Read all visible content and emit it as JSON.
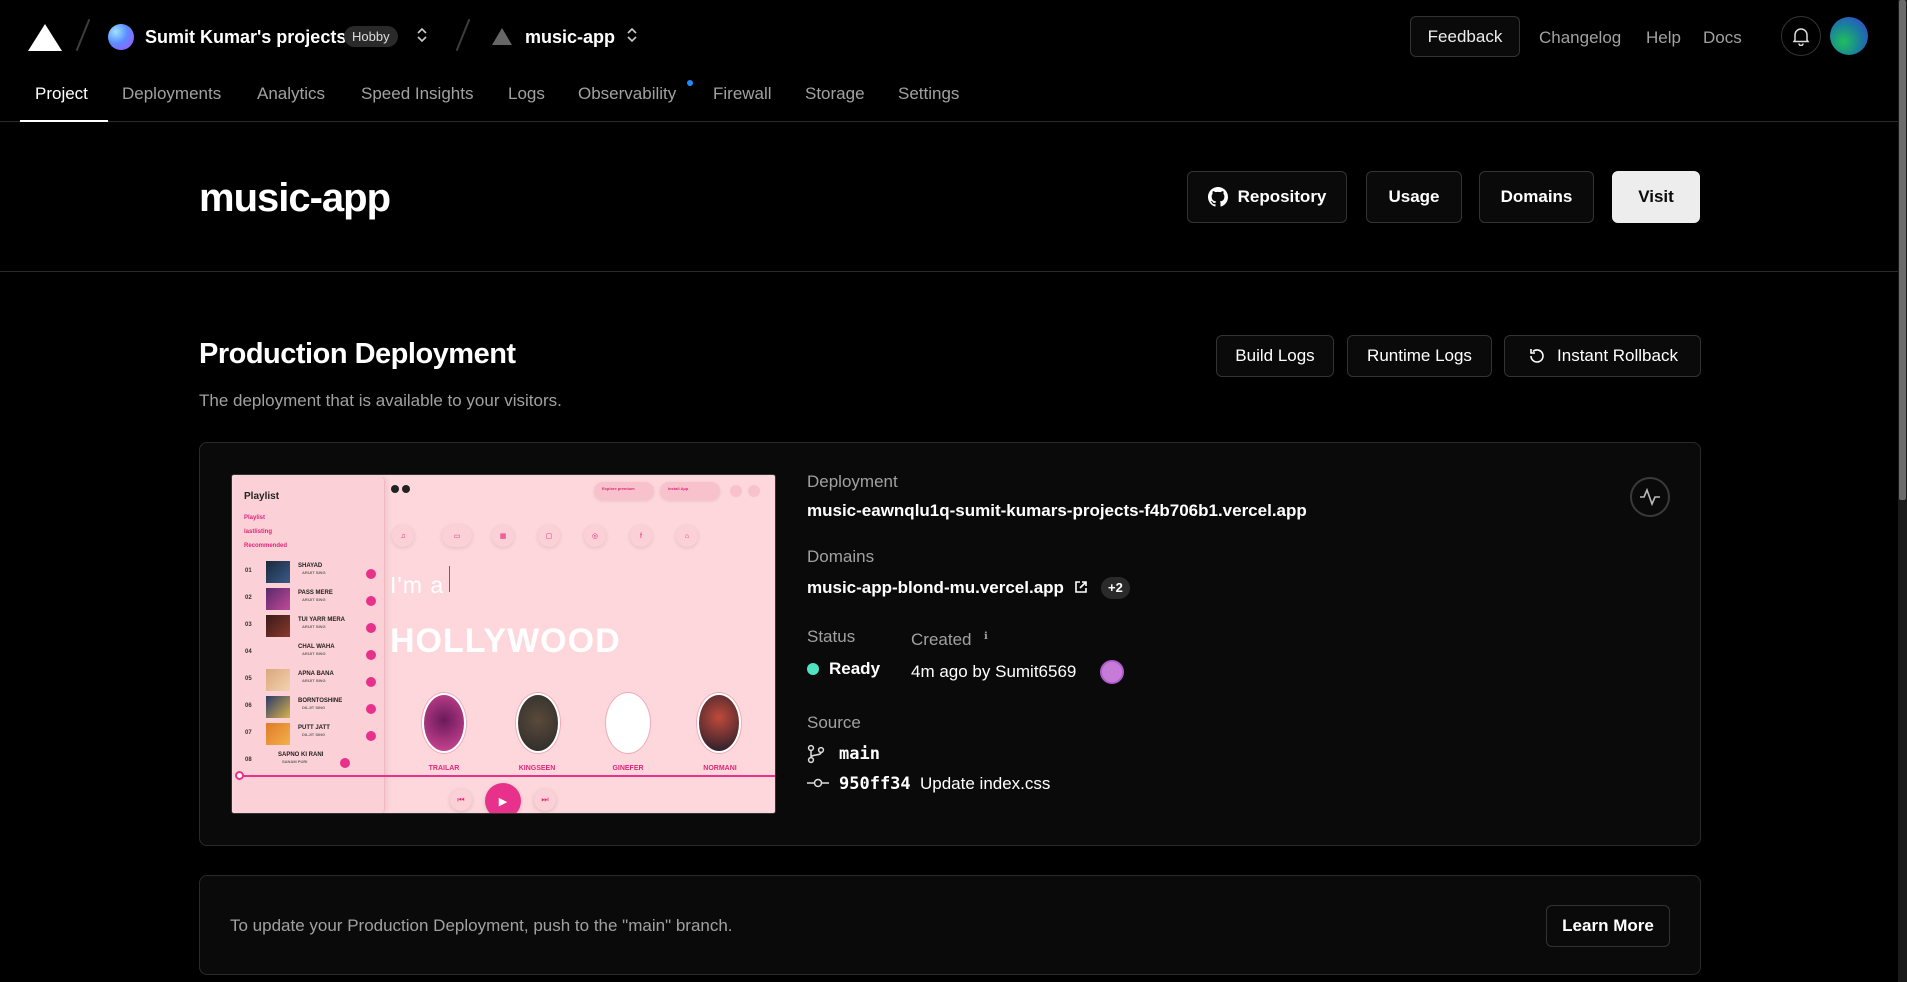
{
  "topbar": {
    "team_name": "Sumit Kumar's projects",
    "plan_badge": "Hobby",
    "project_name": "music-app",
    "feedback_label": "Feedback",
    "links": [
      "Changelog",
      "Help",
      "Docs"
    ]
  },
  "tabs": [
    "Project",
    "Deployments",
    "Analytics",
    "Speed Insights",
    "Logs",
    "Observability",
    "Firewall",
    "Storage",
    "Settings"
  ],
  "active_tab": "Project",
  "header": {
    "title": "music-app",
    "buttons": {
      "repository": "Repository",
      "usage": "Usage",
      "domains": "Domains",
      "visit": "Visit"
    }
  },
  "production": {
    "title": "Production Deployment",
    "subtitle": "The deployment that is available to your visitors.",
    "buttons": {
      "build_logs": "Build Logs",
      "runtime_logs": "Runtime Logs",
      "instant_rollback": "Instant Rollback"
    },
    "deployment_label": "Deployment",
    "deployment_url": "music-eawnqlu1q-sumit-kumars-projects-f4b706b1.vercel.app",
    "domains_label": "Domains",
    "domain": "music-app-blond-mu.vercel.app",
    "extra_domains": "+2",
    "status_label": "Status",
    "status": "Ready",
    "created_label": "Created",
    "created": "4m ago by Sumit6569",
    "source_label": "Source",
    "branch": "main",
    "commit_hash": "950ff34",
    "commit_message": "Update index.css"
  },
  "preview": {
    "sidebar_title": "Playlist",
    "menu": [
      "Playlist",
      "lastlisting",
      "Recommended"
    ],
    "songs": [
      {
        "num": "01",
        "title": "SHAYAD",
        "artist": "ARIJIT SING"
      },
      {
        "num": "02",
        "title": "PASS MERE",
        "artist": "ARIJIT SING"
      },
      {
        "num": "03",
        "title": "TUI YARR MERA",
        "artist": "ARIJIT SING"
      },
      {
        "num": "04",
        "title": "CHAL WAHA",
        "artist": "ARIJIT SING"
      },
      {
        "num": "05",
        "title": "APNA BANA",
        "artist": "ARIJIT SING"
      },
      {
        "num": "06",
        "title": "BORNTOSHINE",
        "artist": "DILJIT SING"
      },
      {
        "num": "07",
        "title": "PUTT JATT",
        "artist": "DILJIT SING"
      },
      {
        "num": "08",
        "title": "SAPNO KI RANI",
        "artist": "SANAM PURI"
      }
    ],
    "pills": [
      "Explore premium",
      "Install App"
    ],
    "headline_small": "I'm a",
    "headline_big": "HOLLYWOOD",
    "artists": [
      "TRAILAR",
      "KINGSEEN",
      "GINEFER",
      "NORMANI"
    ]
  },
  "footer_card": {
    "text": "To update your Production Deployment, push to the \"main\" branch.",
    "button": "Learn More"
  }
}
